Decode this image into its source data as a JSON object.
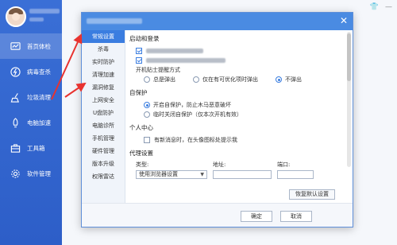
{
  "sidebar": {
    "items": [
      {
        "label": "首页体检",
        "icon": "chart-icon",
        "active": true
      },
      {
        "label": "病毒查杀",
        "icon": "bolt-icon",
        "active": false
      },
      {
        "label": "垃圾清理",
        "icon": "broom-icon",
        "active": false
      },
      {
        "label": "电脑加速",
        "icon": "rocket-icon",
        "active": false
      },
      {
        "label": "工具箱",
        "icon": "toolbox-icon",
        "active": false
      },
      {
        "label": "软件管理",
        "icon": "gear-icon",
        "active": false
      }
    ]
  },
  "dialog": {
    "nav": [
      {
        "label": "常规设置",
        "active": true
      },
      {
        "label": "杀毒"
      },
      {
        "label": "实时防护"
      },
      {
        "label": "清理加速"
      },
      {
        "label": "漏洞修复"
      },
      {
        "label": "上网安全"
      },
      {
        "label": "U盘防护"
      },
      {
        "label": "电脑诊所"
      },
      {
        "label": "手机管理"
      },
      {
        "label": "硬件管理"
      },
      {
        "label": "版本升级"
      },
      {
        "label": "权限雷达"
      }
    ],
    "startup": {
      "title": "启动和登录",
      "tip_label": "开机贴士提醒方式",
      "tip_options": [
        "总是弹出",
        "仅在有可优化项时弹出",
        "不弹出"
      ],
      "tip_selected": 2
    },
    "self_protect": {
      "title": "自保护",
      "options": [
        "开启自保护，防止木马恶意破坏",
        "临时关闭自保护（仅本次开机有效）"
      ],
      "selected": 0
    },
    "personal": {
      "title": "个人中心",
      "option": "有新消息时，在头像图标处提示我"
    },
    "proxy": {
      "title": "代理设置",
      "type_label": "类型:",
      "address_label": "地址:",
      "port_label": "端口:",
      "type_value": "使用浏览器设置",
      "restore_label": "恢复默认设置"
    },
    "ok_label": "确定",
    "cancel_label": "取消",
    "close_icon": "✕"
  },
  "colors": {
    "accent": "#3a7de0",
    "sidebar": "#2d5ec8",
    "title_bar": "#4a8be2",
    "annotation": "#e8322f"
  }
}
